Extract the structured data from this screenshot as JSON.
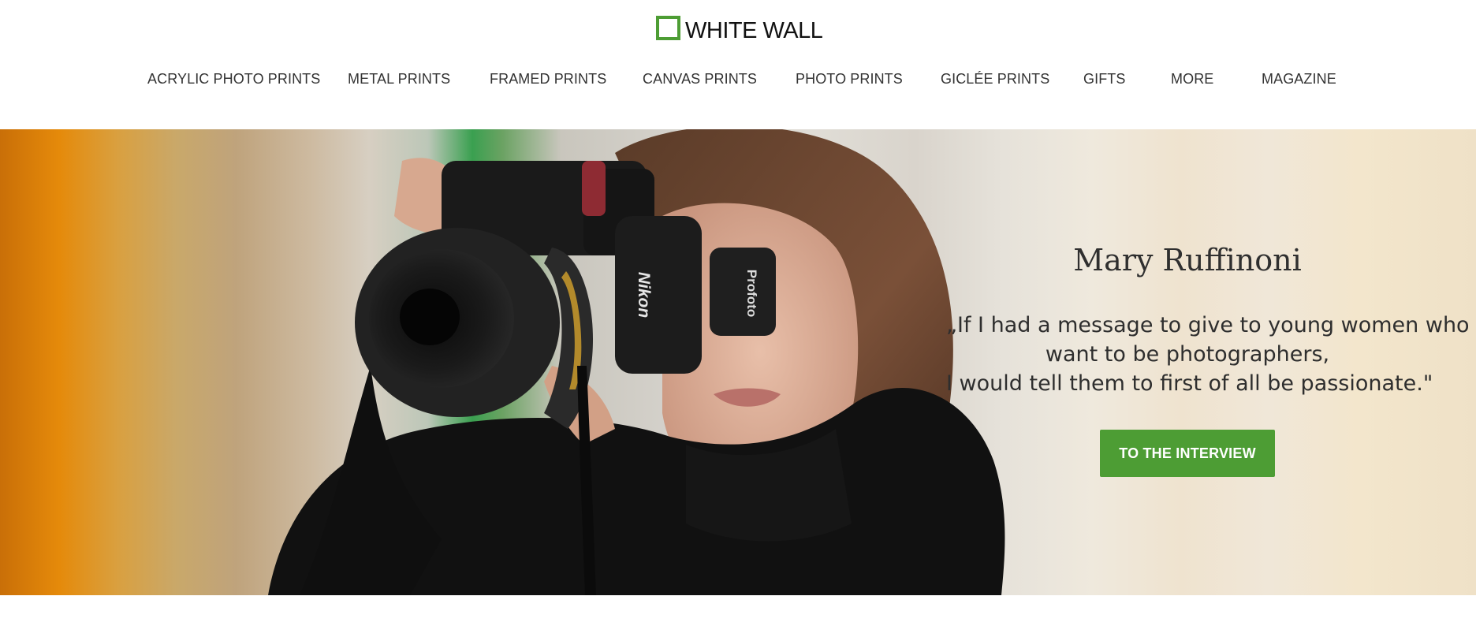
{
  "header": {
    "logo_text": "WHITE WALL",
    "brand_color": "#4d9d34"
  },
  "nav": {
    "items": [
      {
        "label": "ACRYLIC PHOTO PRINTS"
      },
      {
        "label": "METAL PRINTS"
      },
      {
        "label": "FRAMED PRINTS"
      },
      {
        "label": "CANVAS PRINTS"
      },
      {
        "label": "PHOTO PRINTS"
      },
      {
        "label": "GICLÉE PRINTS"
      },
      {
        "label": "GIFTS"
      },
      {
        "label": "MORE"
      },
      {
        "label": "MAGAZINE"
      }
    ]
  },
  "hero": {
    "name": "Mary Ruffinoni",
    "quote_lines": [
      "„If I had a message to give to young women who",
      "want to be photographers,",
      "I would tell them to first of all be passionate.\""
    ],
    "cta_label": "TO THE INTERVIEW",
    "camera_brand": "Nikon",
    "flash_brand": "Profoto"
  }
}
